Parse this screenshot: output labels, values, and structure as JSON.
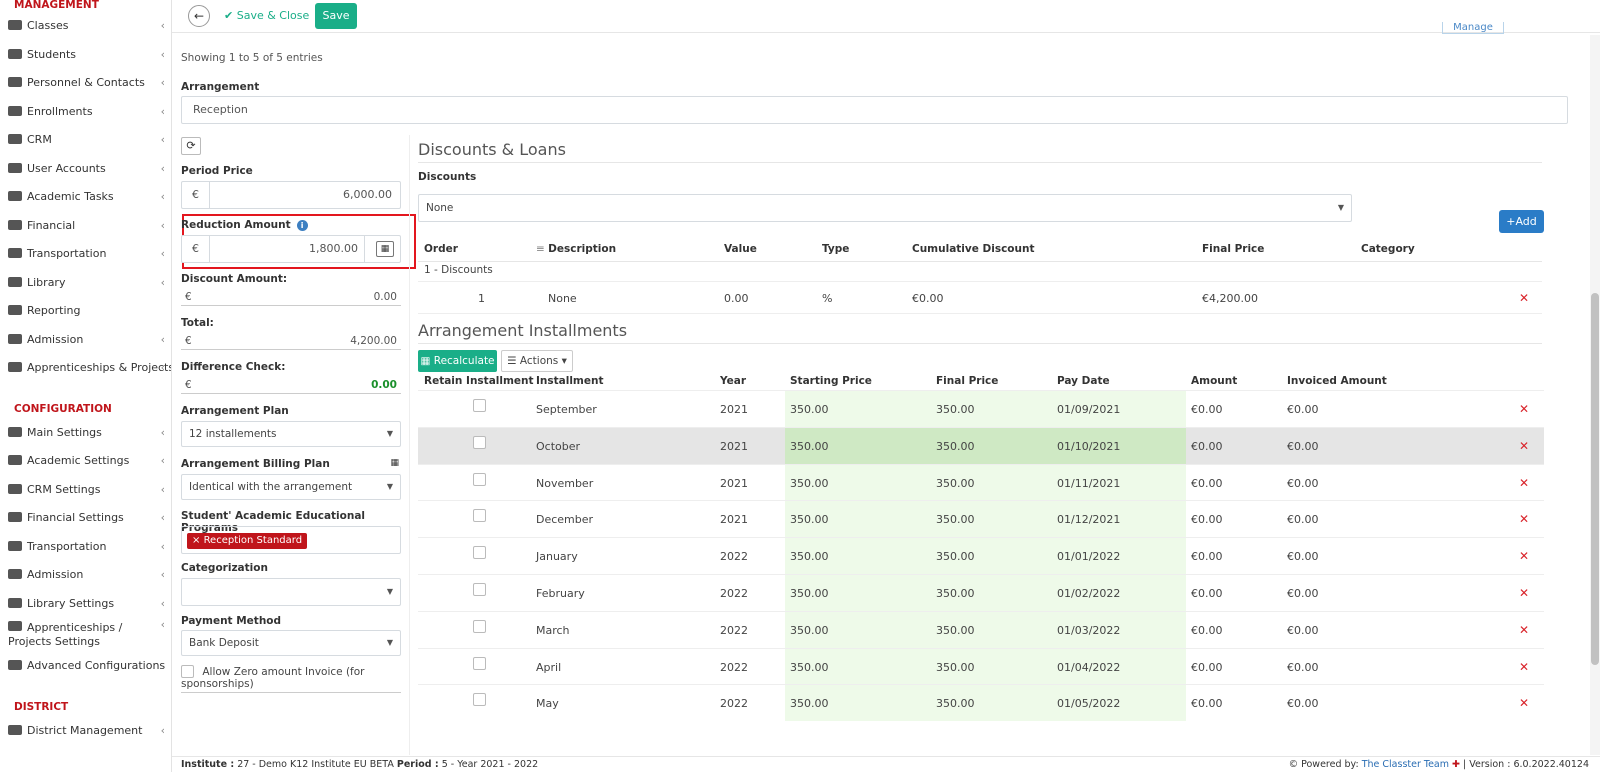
{
  "sidebar": {
    "sections": {
      "management": "MANAGEMENT",
      "configuration": "CONFIGURATION",
      "district": "DISTRICT"
    },
    "management_items": [
      {
        "label": "Classes",
        "icon": "classes-icon"
      },
      {
        "label": "Students",
        "icon": "students-icon"
      },
      {
        "label": "Personnel & Contacts",
        "icon": "personnel-icon"
      },
      {
        "label": "Enrollments",
        "icon": "enrollments-icon"
      },
      {
        "label": "CRM",
        "icon": "crm-icon"
      },
      {
        "label": "User Accounts",
        "icon": "key-icon"
      },
      {
        "label": "Academic Tasks",
        "icon": "grid-icon"
      },
      {
        "label": "Financial",
        "icon": "coins-icon"
      },
      {
        "label": "Transportation",
        "icon": "bus-icon"
      },
      {
        "label": "Library",
        "icon": "books-icon"
      },
      {
        "label": "Reporting",
        "icon": "printer-icon"
      },
      {
        "label": "Admission",
        "icon": "bank-icon"
      },
      {
        "label": "Apprenticeships & Projects",
        "icon": "cube-icon"
      }
    ],
    "configuration_items": [
      {
        "label": "Main Settings",
        "icon": "sliders-icon"
      },
      {
        "label": "Academic Settings",
        "icon": "classes-icon"
      },
      {
        "label": "CRM Settings",
        "icon": "crm-icon"
      },
      {
        "label": "Financial Settings",
        "icon": "coins-icon"
      },
      {
        "label": "Transportation",
        "icon": "bus-icon"
      },
      {
        "label": "Admission",
        "icon": "bank-icon"
      },
      {
        "label": "Library Settings",
        "icon": "books-icon"
      },
      {
        "label": "Apprenticeships / Projects Settings",
        "icon": "cube-icon"
      },
      {
        "label": "Advanced Configurations",
        "icon": "gears-icon"
      }
    ],
    "district_items": [
      {
        "label": "District Management",
        "icon": "list-icon"
      }
    ]
  },
  "toolbar": {
    "back": "←",
    "save_close": "Save & Close",
    "save": "Save",
    "manage": "Manage"
  },
  "entries_text": "Showing 1 to 5 of 5 entries",
  "arrangement": {
    "label": "Arrangement",
    "value": "Reception"
  },
  "form": {
    "period_price": {
      "label": "Period Price",
      "currency": "€",
      "value": "6,000.00"
    },
    "reduction_amount": {
      "label": "Reduction Amount",
      "currency": "€",
      "value": "1,800.00"
    },
    "discount_amount": {
      "label": "Discount Amount:",
      "currency": "€",
      "value": "0.00"
    },
    "total": {
      "label": "Total:",
      "currency": "€",
      "value": "4,200.00"
    },
    "difference_check": {
      "label": "Difference Check:",
      "currency": "€",
      "value": "0.00"
    },
    "arrangement_plan": {
      "label": "Arrangement Plan",
      "value": "12 installements"
    },
    "billing_plan": {
      "label": "Arrangement Billing Plan",
      "value": "Identical with the arrangement"
    },
    "programs": {
      "label": "Student' Academic Educational Programs",
      "tag": "Reception Standard"
    },
    "categorization": {
      "label": "Categorization",
      "value": ""
    },
    "payment_method": {
      "label": "Payment Method",
      "value": "Bank Deposit"
    },
    "allow_zero": "Allow Zero amount Invoice (for sponsorships)"
  },
  "discounts": {
    "title": "Discounts & Loans",
    "label": "Discounts",
    "select_value": "None",
    "add": "Add",
    "headers": [
      "Order",
      "Description",
      "Value",
      "Type",
      "Cumulative Discount",
      "Final Price",
      "Category"
    ],
    "group": "1 - Discounts",
    "row": {
      "order": "1",
      "description": "None",
      "value": "0.00",
      "type": "%",
      "cumulative": "€0.00",
      "final": "€4,200.00"
    }
  },
  "installments": {
    "title": "Arrangement Installments",
    "recalculate": "Recalculate",
    "actions": "Actions",
    "headers": [
      "Retain Installment",
      "Installment",
      "Year",
      "Starting Price",
      "Final Price",
      "Pay Date",
      "Amount",
      "Invoiced Amount"
    ],
    "rows": [
      {
        "installment": "September",
        "year": "2021",
        "start": "350.00",
        "final": "350.00",
        "date": "01/09/2021",
        "amount": "€0.00",
        "invoiced": "€0.00"
      },
      {
        "installment": "October",
        "year": "2021",
        "start": "350.00",
        "final": "350.00",
        "date": "01/10/2021",
        "amount": "€0.00",
        "invoiced": "€0.00"
      },
      {
        "installment": "November",
        "year": "2021",
        "start": "350.00",
        "final": "350.00",
        "date": "01/11/2021",
        "amount": "€0.00",
        "invoiced": "€0.00"
      },
      {
        "installment": "December",
        "year": "2021",
        "start": "350.00",
        "final": "350.00",
        "date": "01/12/2021",
        "amount": "€0.00",
        "invoiced": "€0.00"
      },
      {
        "installment": "January",
        "year": "2022",
        "start": "350.00",
        "final": "350.00",
        "date": "01/01/2022",
        "amount": "€0.00",
        "invoiced": "€0.00"
      },
      {
        "installment": "February",
        "year": "2022",
        "start": "350.00",
        "final": "350.00",
        "date": "01/02/2022",
        "amount": "€0.00",
        "invoiced": "€0.00"
      },
      {
        "installment": "March",
        "year": "2022",
        "start": "350.00",
        "final": "350.00",
        "date": "01/03/2022",
        "amount": "€0.00",
        "invoiced": "€0.00"
      },
      {
        "installment": "April",
        "year": "2022",
        "start": "350.00",
        "final": "350.00",
        "date": "01/04/2022",
        "amount": "€0.00",
        "invoiced": "€0.00"
      },
      {
        "installment": "May",
        "year": "2022",
        "start": "350.00",
        "final": "350.00",
        "date": "01/05/2022",
        "amount": "€0.00",
        "invoiced": "€0.00"
      }
    ]
  },
  "footer": {
    "institute_label": "Institute :",
    "institute_value": "27 - Demo K12 Institute EU BETA",
    "period_label": "Period :",
    "period_value": "5 - Year 2021 - 2022",
    "powered_by": "Powered by:",
    "team": "The Classter Team",
    "version": "| Version : 6.0.2022.40124"
  },
  "colors": {
    "accent_green": "#1aae88",
    "brand_red": "#c0151b",
    "primary_blue": "#2a7cc7",
    "highlight_border": "#e3161e"
  }
}
